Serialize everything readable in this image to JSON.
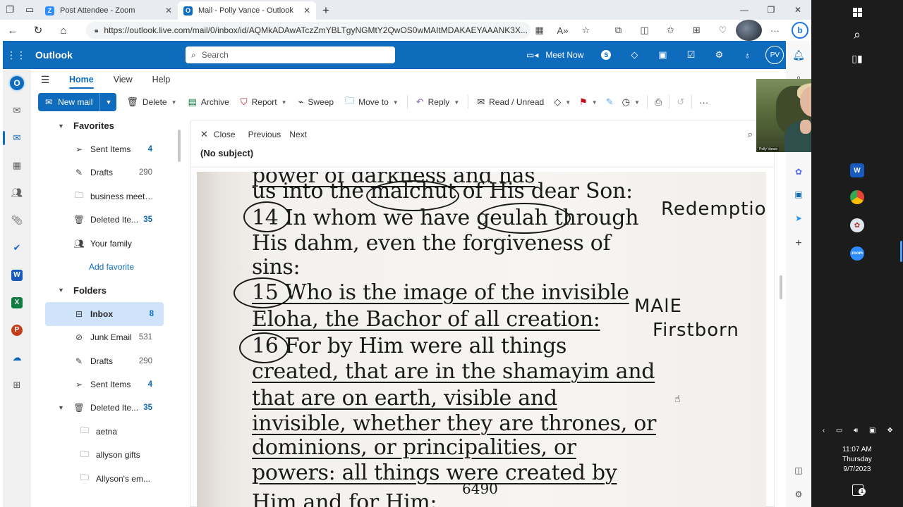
{
  "browser": {
    "tabs": [
      {
        "title": "Post Attendee - Zoom",
        "favicon": "Z",
        "favicon_color": "#2d8cff",
        "active": false
      },
      {
        "title": "Mail - Polly Vance - Outlook",
        "favicon": "O",
        "favicon_color": "#0f6cbd",
        "active": true
      }
    ],
    "url": "https://outlook.live.com/mail/0/inbox/id/AQMkADAwATczZmYBLTgyNGMtY2QwOS0wMAItMDAKAEYAAANK3X..."
  },
  "outlook": {
    "brand": "Outlook",
    "search_placeholder": "Search",
    "meet_now": "Meet Now",
    "avatar_initials": "PV",
    "accent": "#0f6cbd",
    "ribbon_tabs": [
      "Home",
      "View",
      "Help"
    ],
    "commands": {
      "new_mail": "New mail",
      "delete": "Delete",
      "archive": "Archive",
      "report": "Report",
      "sweep": "Sweep",
      "move_to": "Move to",
      "reply": "Reply",
      "read_unread": "Read / Unread"
    },
    "favorites_label": "Favorites",
    "favorites": [
      {
        "label": "Sent Items",
        "count": "4",
        "icon": "send-icon",
        "count_style": "blue"
      },
      {
        "label": "Drafts",
        "count": "290",
        "icon": "pencil-icon",
        "count_style": "gray"
      },
      {
        "label": "business meeti...",
        "count": "",
        "icon": "folder-icon",
        "count_style": "gray"
      },
      {
        "label": "Deleted Ite...",
        "count": "35",
        "icon": "trash-icon",
        "count_style": "blue"
      },
      {
        "label": "Your family",
        "count": "",
        "icon": "people-icon",
        "count_style": "gray"
      }
    ],
    "add_favorite": "Add favorite",
    "folders_label": "Folders",
    "folders": [
      {
        "label": "Inbox",
        "count": "8",
        "icon": "inbox-icon",
        "count_style": "blue",
        "selected": true
      },
      {
        "label": "Junk Email",
        "count": "531",
        "icon": "junk-icon",
        "count_style": "gray"
      },
      {
        "label": "Drafts",
        "count": "290",
        "icon": "pencil-icon",
        "count_style": "gray"
      },
      {
        "label": "Sent Items",
        "count": "4",
        "icon": "send-icon",
        "count_style": "blue"
      },
      {
        "label": "Deleted Ite...",
        "count": "35",
        "icon": "trash-icon",
        "count_style": "blue"
      }
    ],
    "subfolders": [
      "aetna",
      "allyson gifts",
      "Allyson's em..."
    ],
    "reading": {
      "close": "Close",
      "previous": "Previous",
      "next": "Next",
      "subject": "(No subject)"
    }
  },
  "scan": {
    "lines": [
      "power of darkness and has",
      "us into the malchut of His dear Son:",
      "14 In whom we have geulah through",
      "His dahm, even the forgiveness of",
      "sins:",
      "15 Who is the image of the invisible",
      "Eloha, the Bachor of all creation:",
      "16 For by Him were all things",
      "created, that are in the shamayim and",
      "that are on earth, visible and",
      "invisible, whether they are thrones, or",
      "dominions, or principalities, or",
      "powers: all things were created by",
      "Him and for Him:"
    ],
    "notes": [
      "Redemption",
      "MAlE",
      "Firstborn"
    ],
    "page_number": "6490"
  },
  "taskbar": {
    "time": "11:07 AM",
    "day": "Thursday",
    "date": "9/7/2023",
    "notification_count": "1"
  },
  "webcam": {
    "label": "Polly Vance"
  }
}
